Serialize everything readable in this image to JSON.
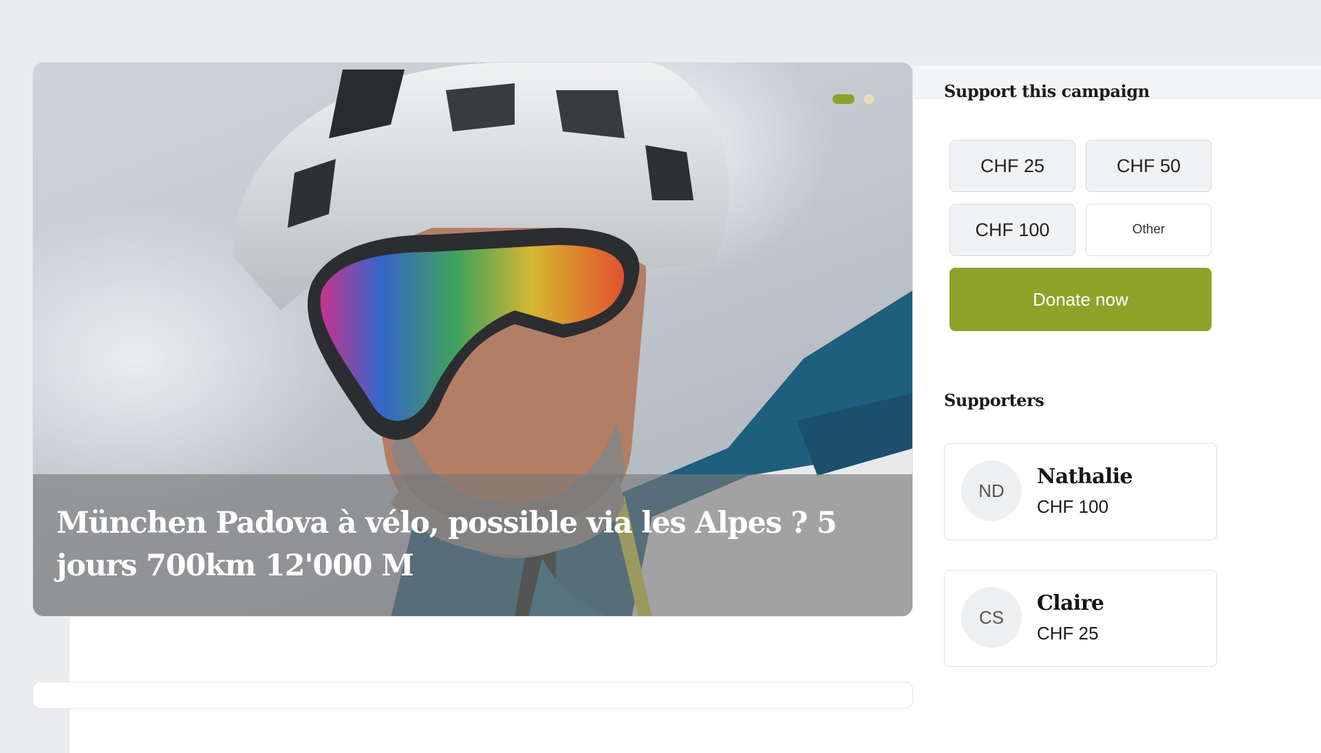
{
  "window": {
    "controls": [
      "close",
      "minimize",
      "maximize"
    ]
  },
  "campaign": {
    "title": "München Padova à vélo, possible via les Alpes ? 5 jours 700km 12'000 M",
    "carousel": {
      "slides": 2,
      "active": 1
    }
  },
  "support": {
    "title": "Support this campaign",
    "amounts": [
      "CHF 25",
      "CHF 50",
      "CHF 100",
      "Other"
    ],
    "donate_label": "Donate now"
  },
  "supporters": {
    "title": "Supporters",
    "items": [
      {
        "initials": "ND",
        "name": "Nathalie",
        "amount": "CHF 100"
      },
      {
        "initials": "CS",
        "name": "Claire",
        "amount": "CHF 25"
      }
    ]
  },
  "colors": {
    "accent": "#8fa32b",
    "background": "#eaecf0"
  }
}
